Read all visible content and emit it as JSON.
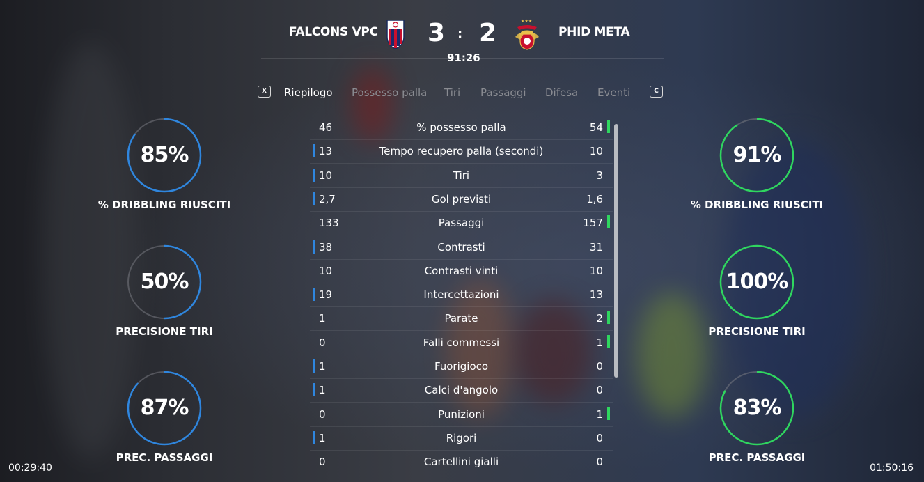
{
  "match": {
    "home_team": "FALCONS VPC",
    "away_team": "PHID META",
    "home_score": "3",
    "away_score": "2",
    "separator": ":",
    "clock": "91:26",
    "colors": {
      "home_accent": "#2f86de",
      "away_accent": "#2fd65f"
    }
  },
  "tabs": {
    "prev_key": "X",
    "next_key": "C",
    "items": [
      "Riepilogo",
      "Possesso palla",
      "Tiri",
      "Passaggi",
      "Difesa",
      "Eventi"
    ],
    "active": "Riepilogo"
  },
  "home_rings": [
    {
      "value": "85%",
      "label": "% DRIBBLING RIUSCITI",
      "fraction": 0.85
    },
    {
      "value": "50%",
      "label": "PRECISIONE TIRI",
      "fraction": 0.5
    },
    {
      "value": "87%",
      "label": "PREC. PASSAGGI",
      "fraction": 0.87
    }
  ],
  "away_rings": [
    {
      "value": "91%",
      "label": "% DRIBBLING RIUSCITI",
      "fraction": 0.91
    },
    {
      "value": "100%",
      "label": "PRECISIONE TIRI",
      "fraction": 1.0
    },
    {
      "value": "83%",
      "label": "PREC. PASSAGGI",
      "fraction": 0.83
    }
  ],
  "stats": [
    {
      "name": "% possesso palla",
      "home": "46",
      "away": "54",
      "leader": "away"
    },
    {
      "name": "Tempo recupero palla (secondi)",
      "home": "13",
      "away": "10",
      "leader": "home"
    },
    {
      "name": "Tiri",
      "home": "10",
      "away": "3",
      "leader": "home"
    },
    {
      "name": "Gol previsti",
      "home": "2,7",
      "away": "1,6",
      "leader": "home"
    },
    {
      "name": "Passaggi",
      "home": "133",
      "away": "157",
      "leader": "away"
    },
    {
      "name": "Contrasti",
      "home": "38",
      "away": "31",
      "leader": "home"
    },
    {
      "name": "Contrasti vinti",
      "home": "10",
      "away": "10",
      "leader": "none"
    },
    {
      "name": "Intercettazioni",
      "home": "19",
      "away": "13",
      "leader": "home"
    },
    {
      "name": "Parate",
      "home": "1",
      "away": "2",
      "leader": "away"
    },
    {
      "name": "Falli commessi",
      "home": "0",
      "away": "1",
      "leader": "away"
    },
    {
      "name": "Fuorigioco",
      "home": "1",
      "away": "0",
      "leader": "home"
    },
    {
      "name": "Calci d'angolo",
      "home": "1",
      "away": "0",
      "leader": "home"
    },
    {
      "name": "Punizioni",
      "home": "0",
      "away": "1",
      "leader": "away"
    },
    {
      "name": "Rigori",
      "home": "1",
      "away": "0",
      "leader": "home"
    },
    {
      "name": "Cartellini gialli",
      "home": "0",
      "away": "0",
      "leader": "none"
    }
  ],
  "timers": {
    "left": "00:29:40",
    "right": "01:50:16"
  }
}
